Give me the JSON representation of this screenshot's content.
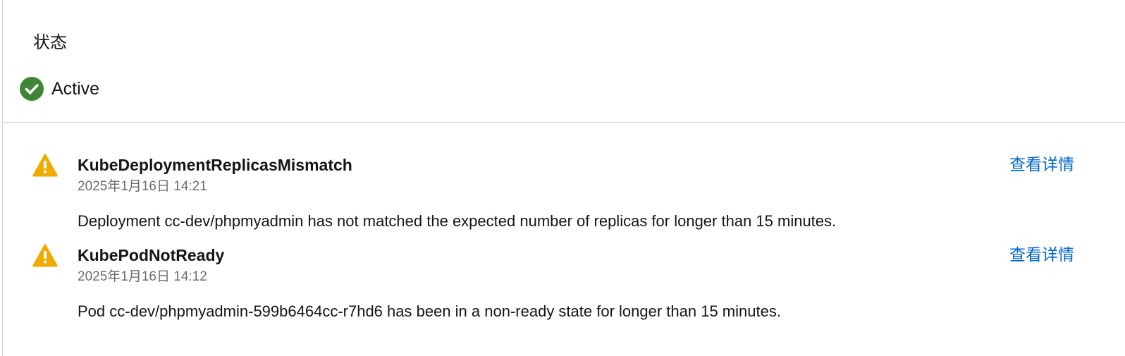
{
  "status": {
    "heading": "状态",
    "value": "Active",
    "icon": "check-circle-icon",
    "color": "#3e8635"
  },
  "alerts": [
    {
      "icon": "warning-triangle-icon",
      "title": "KubeDeploymentReplicasMismatch",
      "time": "2025年1月16日 14:21",
      "description": "Deployment cc-dev/phpmyadmin has not matched the expected number of replicas for longer than 15 minutes.",
      "link": "查看详情"
    },
    {
      "icon": "warning-triangle-icon",
      "title": "KubePodNotReady",
      "time": "2025年1月16日 14:12",
      "description": "Pod cc-dev/phpmyadmin-599b6464cc-r7hd6 has been in a non-ready state for longer than 15 minutes.",
      "link": "查看详情"
    }
  ],
  "colors": {
    "warning": "#f0ab00",
    "link": "#0066cc",
    "success": "#3e8635"
  }
}
